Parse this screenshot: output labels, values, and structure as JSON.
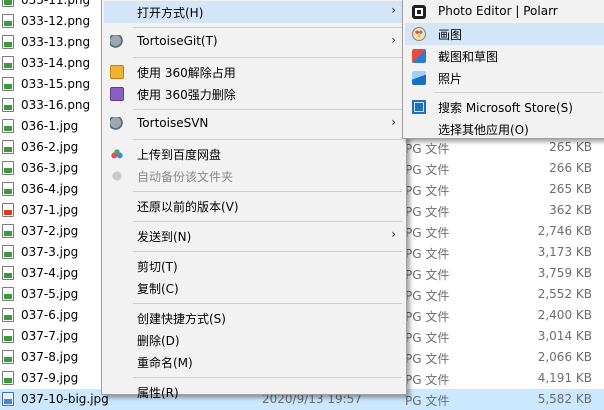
{
  "files": [
    {
      "name": "033-11.png",
      "date": "",
      "type": "",
      "size": "",
      "icon": "green-doc-icon"
    },
    {
      "name": "033-12.png",
      "date": "",
      "type": "",
      "size": "",
      "icon": "green-doc-icon"
    },
    {
      "name": "033-13.png",
      "date": "",
      "type": "",
      "size": "",
      "icon": "green-doc-icon"
    },
    {
      "name": "033-14.png",
      "date": "",
      "type": "",
      "size": "",
      "icon": "green-doc-icon"
    },
    {
      "name": "033-15.png",
      "date": "",
      "type": "",
      "size": "",
      "icon": "green-doc-icon"
    },
    {
      "name": "033-16.png",
      "date": "",
      "type": "",
      "size": "",
      "icon": "green-doc-icon"
    },
    {
      "name": "036-1.jpg",
      "date": "",
      "type": "",
      "size": "",
      "icon": "green-doc-icon"
    },
    {
      "name": "036-2.jpg",
      "date": "",
      "type": "PG 文件",
      "size": "265 KB",
      "icon": "green-doc-icon"
    },
    {
      "name": "036-3.jpg",
      "date": "",
      "type": "PG 文件",
      "size": "266 KB",
      "icon": "green-doc-icon"
    },
    {
      "name": "036-4.jpg",
      "date": "",
      "type": "PG 文件",
      "size": "265 KB",
      "icon": "green-doc-icon"
    },
    {
      "name": "037-1.jpg",
      "date": "",
      "type": "PG 文件",
      "size": "362 KB",
      "icon": "warning-doc-icon"
    },
    {
      "name": "037-2.jpg",
      "date": "",
      "type": "PG 文件",
      "size": "2,746 KB",
      "icon": "green-doc-icon"
    },
    {
      "name": "037-3.jpg",
      "date": "",
      "type": "PG 文件",
      "size": "3,173 KB",
      "icon": "green-doc-icon"
    },
    {
      "name": "037-4.jpg",
      "date": "",
      "type": "PG 文件",
      "size": "3,759 KB",
      "icon": "green-doc-icon"
    },
    {
      "name": "037-5.jpg",
      "date": "",
      "type": "PG 文件",
      "size": "2,552 KB",
      "icon": "green-doc-icon"
    },
    {
      "name": "037-6.jpg",
      "date": "",
      "type": "PG 文件",
      "size": "2,400 KB",
      "icon": "green-doc-icon"
    },
    {
      "name": "037-7.jpg",
      "date": "",
      "type": "PG 文件",
      "size": "3,014 KB",
      "icon": "green-doc-icon"
    },
    {
      "name": "037-8.jpg",
      "date": "",
      "type": "PG 文件",
      "size": "2,066 KB",
      "icon": "green-doc-icon"
    },
    {
      "name": "037-9.jpg",
      "date": "",
      "type": "PG 文件",
      "size": "4,191 KB",
      "icon": "green-doc-icon"
    },
    {
      "name": "037-10-big.jpg",
      "date": "2020/9/13 19:57",
      "type": "PG 文件",
      "size": "5,582 KB",
      "icon": "image-doc-icon",
      "selected": true
    }
  ],
  "context_menu": {
    "items": [
      {
        "label": "打开方式(H)",
        "submenu": true,
        "hover": true,
        "icon": ""
      },
      {
        "sep": true
      },
      {
        "label": "TortoiseGit(T)",
        "submenu": true,
        "icon": "tortoisegit-icon"
      },
      {
        "sep": true
      },
      {
        "label": "使用 360解除占用",
        "icon": "360-unlock-icon"
      },
      {
        "label": "使用 360强力删除",
        "icon": "360-delete-icon"
      },
      {
        "sep": true
      },
      {
        "label": "TortoiseSVN",
        "submenu": true,
        "icon": "tortoisesvn-icon"
      },
      {
        "sep": true
      },
      {
        "label": "上传到百度网盘",
        "icon": "baidu-cloud-icon"
      },
      {
        "label": "自动备份该文件夹",
        "disabled": true,
        "icon": "baidu-backup-icon"
      },
      {
        "sep": true
      },
      {
        "label": "还原以前的版本(V)",
        "icon": ""
      },
      {
        "sep": true
      },
      {
        "label": "发送到(N)",
        "submenu": true,
        "icon": ""
      },
      {
        "sep": true
      },
      {
        "label": "剪切(T)",
        "icon": ""
      },
      {
        "label": "复制(C)",
        "icon": ""
      },
      {
        "sep": true
      },
      {
        "label": "创建快捷方式(S)",
        "icon": ""
      },
      {
        "label": "删除(D)",
        "icon": ""
      },
      {
        "label": "重命名(M)",
        "icon": ""
      },
      {
        "sep": true
      },
      {
        "label": "属性(R)",
        "icon": ""
      }
    ]
  },
  "open_with_submenu": {
    "items": [
      {
        "label": "Photo Editor | Polarr",
        "icon": "polarr-icon"
      },
      {
        "label": "画图",
        "icon": "paint-icon",
        "hover": true
      },
      {
        "label": "截图和草图",
        "icon": "snip-sketch-icon"
      },
      {
        "label": "照片",
        "icon": "photos-icon"
      },
      {
        "sep": true
      },
      {
        "label": "搜索 Microsoft Store(S)",
        "icon": "store-icon"
      },
      {
        "label": "选择其他应用(O)",
        "icon": ""
      }
    ]
  },
  "colors": {
    "menu_bg": "#f2f2f2",
    "hover_bg": "#d4e5f7",
    "selected_row_bg": "#cce8ff"
  }
}
